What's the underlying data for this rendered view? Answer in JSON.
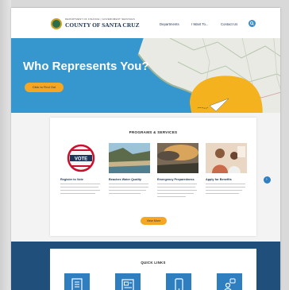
{
  "header": {
    "brand_top": "DEPARTMENT OF FINANCE  |  GOVERNMENT SERVICES",
    "brand": "COUNTY OF SANTA CRUZ",
    "nav": [
      {
        "label": "Departments"
      },
      {
        "label": "I Want To..."
      },
      {
        "label": "Contact Us"
      }
    ]
  },
  "hero": {
    "title": "Who Represents You?",
    "button": "Click to Find Out"
  },
  "programs": {
    "title": "PROGRAMS & SERVICES",
    "items": [
      {
        "title": "Register to Vote",
        "icon": "vote-button-image"
      },
      {
        "title": "Beaches Water Quality",
        "icon": "beach-image"
      },
      {
        "title": "Emergency Preparedness",
        "icon": "storm-image"
      },
      {
        "title": "Apply for Benefits",
        "icon": "family-image"
      }
    ],
    "view_button": "View More"
  },
  "quick_links": {
    "title": "QUICK LINKS",
    "items": [
      {
        "icon": "document-list-icon"
      },
      {
        "icon": "newspaper-icon"
      },
      {
        "icon": "phone-icon"
      },
      {
        "icon": "people-chat-icon"
      }
    ]
  },
  "colors": {
    "accent": "#f5a623",
    "hero_bg": "#3697cf",
    "navy": "#1f4f7a"
  }
}
